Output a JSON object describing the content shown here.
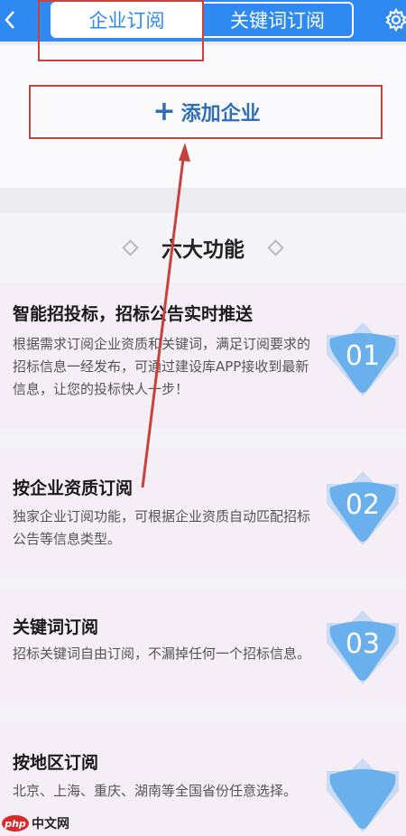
{
  "header": {
    "tabs": [
      {
        "label": "企业订阅",
        "active": true
      },
      {
        "label": "关键词订阅",
        "active": false
      }
    ],
    "back_icon": "chevron-left-icon",
    "settings_icon": "gear-icon"
  },
  "add_company": {
    "label": "添加企业"
  },
  "features": {
    "title": "六大功能",
    "items": [
      {
        "title": "智能招投标，招标公告实时推送",
        "desc": "根据需求订阅企业资质和关键词，满足订阅要求的招标信息一经发布，可通过建设库APP接收到最新信息，让您的投标快人一步！",
        "badge": "01"
      },
      {
        "title": "按企业资质订阅",
        "desc": "独家企业订阅功能，可根据企业资质自动匹配招标公告等信息类型。",
        "badge": "02"
      },
      {
        "title": "关键词订阅",
        "desc": "招标关键词自由订阅，不漏掉任何一个招标信息。",
        "badge": "03"
      },
      {
        "title": "按地区订阅",
        "desc": "北京、上海、重庆、湖南等全国省份任意选择。",
        "badge": ""
      }
    ]
  },
  "watermark": {
    "logo": "php",
    "text": "中文网"
  },
  "colors": {
    "brand_blue": "#2e89f0",
    "annotation_red": "#c8413a",
    "badge_blue": "#7ab8ee"
  }
}
